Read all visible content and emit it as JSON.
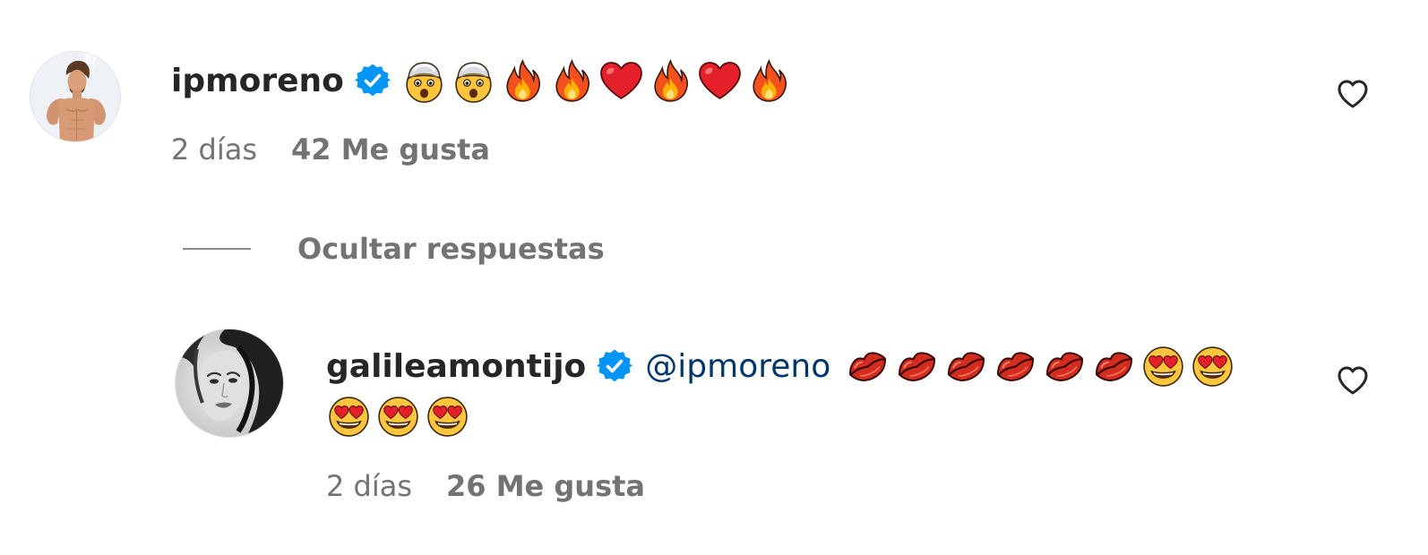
{
  "comment": {
    "username": "ipmoreno",
    "verified": true,
    "emojis": [
      "exploding-head",
      "exploding-head",
      "fire",
      "fire",
      "red-heart",
      "fire",
      "red-heart",
      "fire"
    ],
    "time": "2 días",
    "likes": "42 Me gusta"
  },
  "replies_toggle": {
    "label": "Ocultar respuestas"
  },
  "reply": {
    "username": "galileamontijo",
    "verified": true,
    "mention": "@ipmoreno",
    "emojis_line1": [
      "kiss-mark",
      "kiss-mark",
      "kiss-mark",
      "kiss-mark",
      "kiss-mark",
      "kiss-mark",
      "heart-eyes",
      "heart-eyes"
    ],
    "emojis_line2": [
      "heart-eyes",
      "heart-eyes",
      "heart-eyes"
    ],
    "time": "2 días",
    "likes": "26 Me gusta"
  },
  "colors": {
    "text_primary": "#262626",
    "text_secondary": "#737373",
    "mention": "#00376b",
    "verified_badge": "#0095f6"
  },
  "icons": {
    "like": "heart-outline-icon",
    "verified": "verified-badge-icon"
  }
}
